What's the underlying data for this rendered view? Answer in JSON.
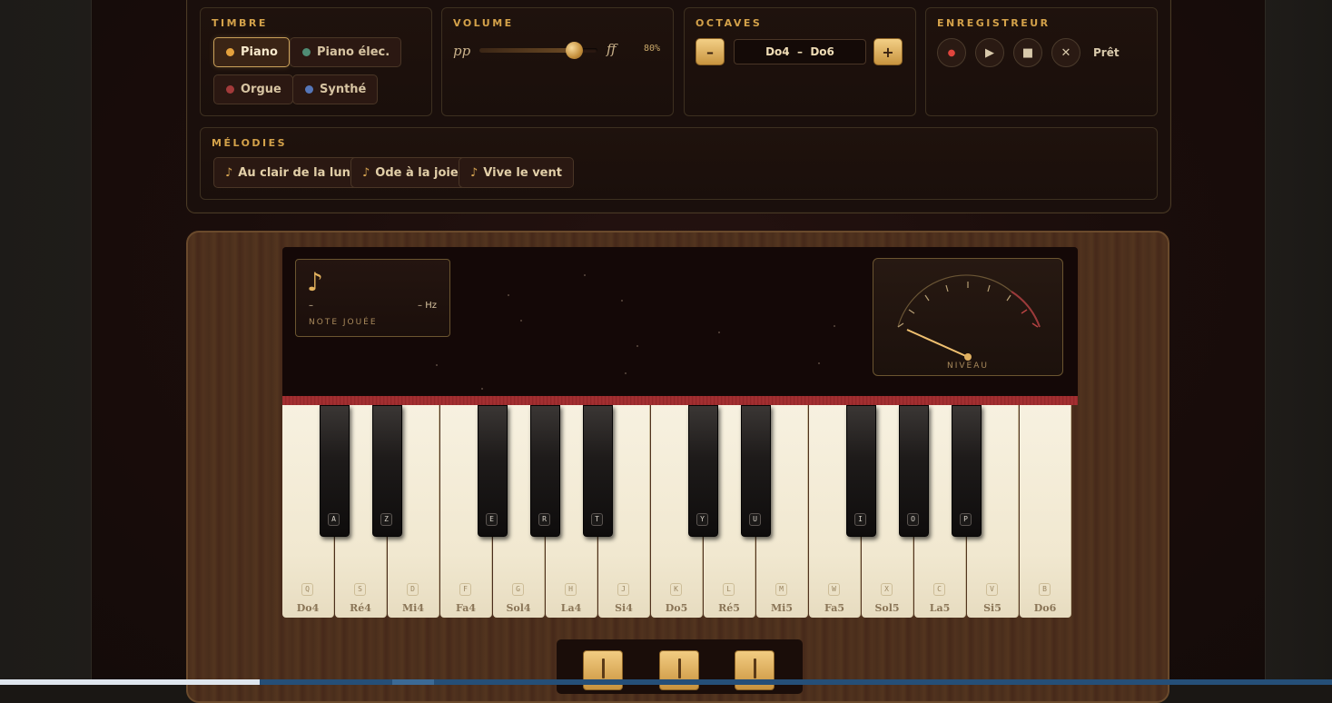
{
  "timbre": {
    "title": "TIMBRE",
    "options": [
      {
        "label": "Piano",
        "dot": "#e3a13d",
        "active": true
      },
      {
        "label": "Piano élec.",
        "dot": "#4f8c74",
        "active": false
      },
      {
        "label": "Orgue",
        "dot": "#a23a3a",
        "active": false
      },
      {
        "label": "Synthé",
        "dot": "#5576b8",
        "active": false
      }
    ]
  },
  "volume": {
    "title": "VOLUME",
    "min_label": "pp",
    "max_label": "ff",
    "value": "80%",
    "fraction": 0.8
  },
  "octaves": {
    "title": "OCTAVES",
    "decrement": "–",
    "increment": "+",
    "range": "Do4  –  Do6"
  },
  "recorder": {
    "title": "ENREGISTREUR",
    "record_icon": "●",
    "play_icon": "▶",
    "stop_icon": "■",
    "clear_icon": "✕",
    "status": "Prêt"
  },
  "melodies": {
    "title": "MÉLODIES",
    "items": [
      {
        "icon": "♪",
        "label": "Au clair de la lune"
      },
      {
        "icon": "♪",
        "label": "Ode à la joie"
      },
      {
        "icon": "♪",
        "label": "Vive le vent"
      }
    ]
  },
  "display": {
    "note_icon": "♪",
    "note_value": "–",
    "frequency": "– Hz",
    "note_label": "NOTE JOUÉE",
    "gauge_label": "NIVEAU",
    "gauge_level": 0.15
  },
  "keyboard": {
    "white_keys": [
      {
        "key": "Q",
        "note": "Do4"
      },
      {
        "key": "S",
        "note": "Ré4"
      },
      {
        "key": "D",
        "note": "Mi4"
      },
      {
        "key": "F",
        "note": "Fa4"
      },
      {
        "key": "G",
        "note": "Sol4"
      },
      {
        "key": "H",
        "note": "La4"
      },
      {
        "key": "J",
        "note": "Si4"
      },
      {
        "key": "K",
        "note": "Do5"
      },
      {
        "key": "L",
        "note": "Ré5"
      },
      {
        "key": "M",
        "note": "Mi5"
      },
      {
        "key": "W",
        "note": "Fa5"
      },
      {
        "key": "X",
        "note": "Sol5"
      },
      {
        "key": "C",
        "note": "La5"
      },
      {
        "key": "V",
        "note": "Si5"
      },
      {
        "key": "B",
        "note": "Do6"
      }
    ],
    "black_keys": [
      {
        "key": "A",
        "after": 0
      },
      {
        "key": "Z",
        "after": 1
      },
      {
        "key": "E",
        "after": 3
      },
      {
        "key": "R",
        "after": 4
      },
      {
        "key": "T",
        "after": 5
      },
      {
        "key": "Y",
        "after": 7
      },
      {
        "key": "U",
        "after": 8
      },
      {
        "key": "I",
        "after": 10
      },
      {
        "key": "O",
        "after": 11
      },
      {
        "key": "P",
        "after": 12
      }
    ]
  }
}
